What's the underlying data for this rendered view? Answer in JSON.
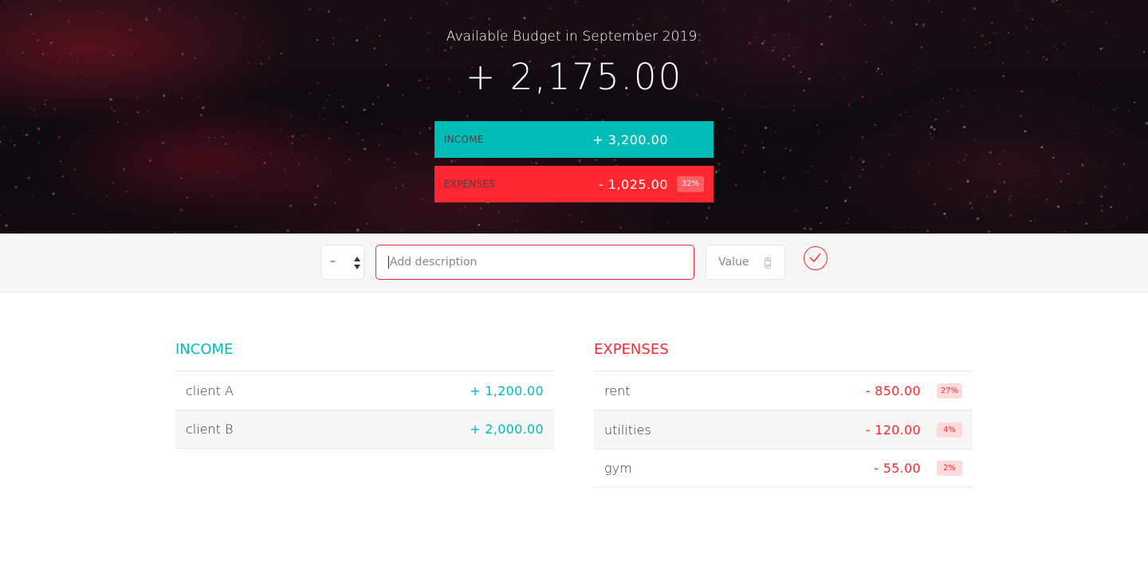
{
  "header": {
    "title": "Available Budget in September 2019:",
    "budget_value": "+ 2,175.00",
    "income": {
      "label": "Income",
      "value": "+ 3,200.00"
    },
    "expenses": {
      "label": "Expenses",
      "value": "- 1,025.00",
      "percentage": "32%"
    }
  },
  "add_bar": {
    "type_value": "–",
    "description_placeholder": "Add description",
    "value_placeholder": "Value"
  },
  "income_list": {
    "title": "Income",
    "items": [
      {
        "description": "client A",
        "value": "+ 1,200.00"
      },
      {
        "description": "client B",
        "value": "+ 2,000.00"
      }
    ]
  },
  "expenses_list": {
    "title": "Expenses",
    "items": [
      {
        "description": "rent",
        "value": "- 850.00",
        "percentage": "27%"
      },
      {
        "description": "utilities",
        "value": "- 120.00",
        "percentage": "4%"
      },
      {
        "description": "gym",
        "value": "- 55.00",
        "percentage": "2%"
      }
    ]
  },
  "colors": {
    "income_accent": "#00bcb8",
    "expense_accent": "#ff2830",
    "percentage_bg": "#ffdad9"
  }
}
